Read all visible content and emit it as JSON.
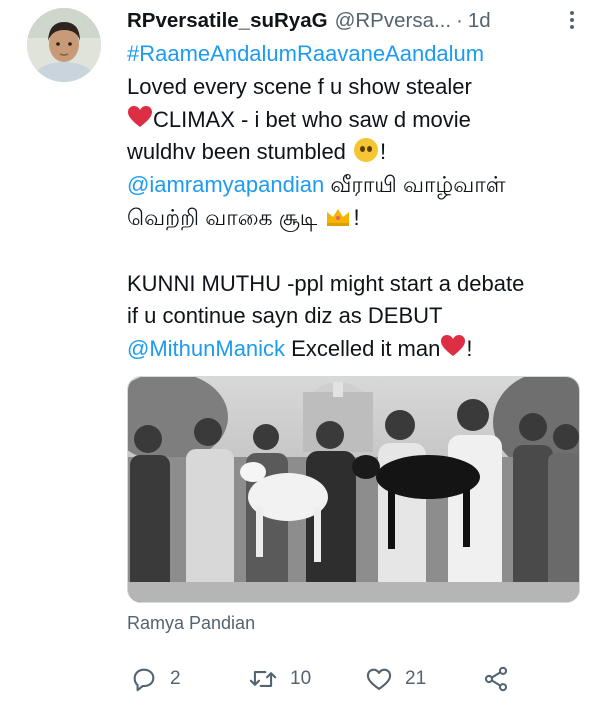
{
  "tweet": {
    "display_name": "RPversatile_suRyaG",
    "handle": "@RPversa...",
    "separator": "·",
    "time": "1d",
    "lines": {
      "hashtag": "#RaameAndalumRaavaneAandalum",
      "l2": "Loved every scene f u show stealer",
      "l3_text": "CLIMAX - i bet who saw d movie",
      "l4_text": "wuldhv been stumbled",
      "l4_end": "!",
      "l5_mention": "@iamramyapandian",
      "l5_text": " வீராயி வாழ்வாள்",
      "l6_text": "வெற்றி வாகை சூடி",
      "l6_end": "!",
      "l8": "KUNNI MUTHU -ppl might start a debate",
      "l9": "if u continue sayn diz as DEBUT",
      "l10_mention": "@MithunManick",
      "l10_text": " Excelled it man",
      "l10_end": "!"
    },
    "media_tag": "Ramya Pandian",
    "actions": {
      "reply_count": "2",
      "retweet_count": "10",
      "like_count": "21"
    }
  },
  "colors": {
    "link": "#1d9bf0",
    "muted": "#536471",
    "heart": "#e0245e"
  },
  "icons": [
    "reply-icon",
    "retweet-icon",
    "like-icon",
    "share-icon",
    "more-icon",
    "red-heart-emoji",
    "pleading-face-emoji",
    "crown-emoji"
  ]
}
